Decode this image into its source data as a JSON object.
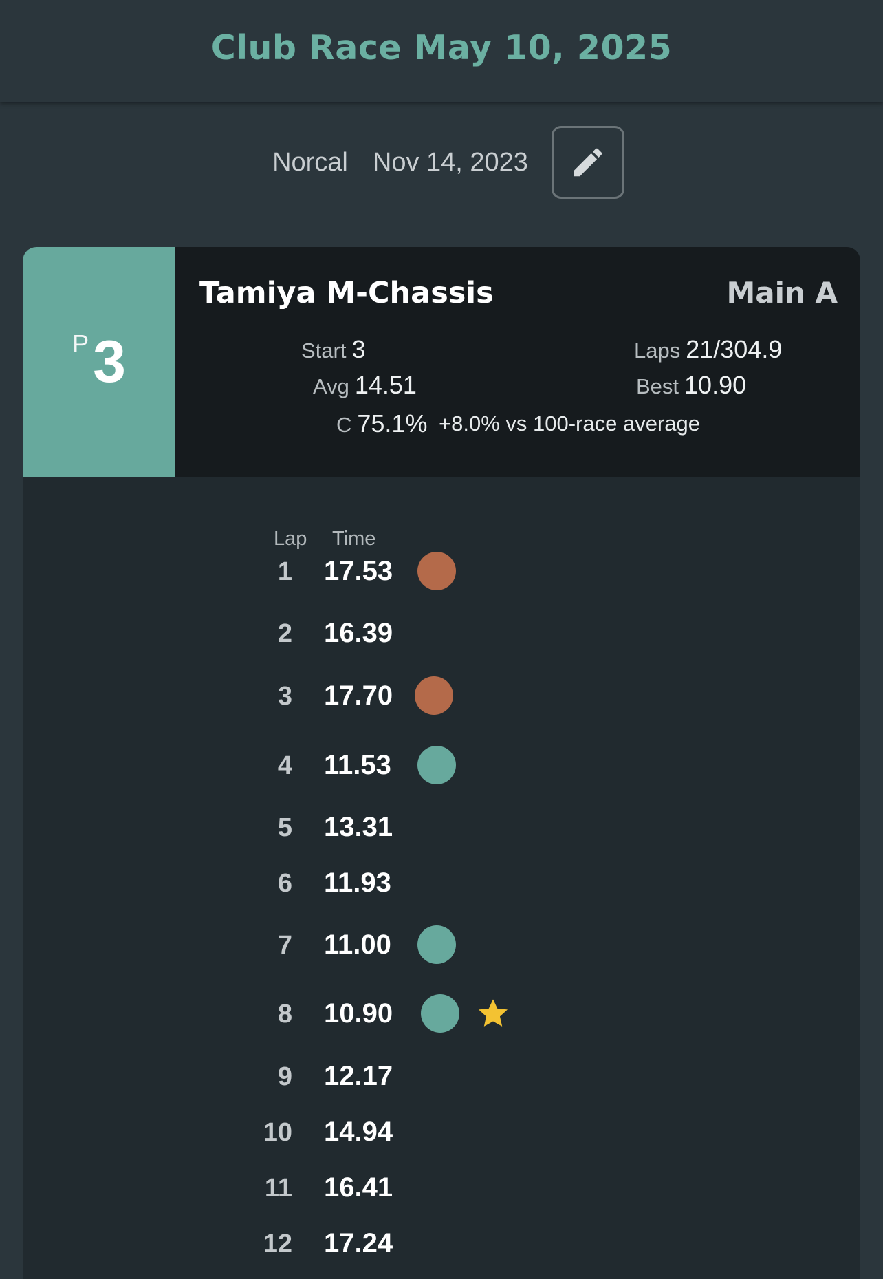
{
  "header": {
    "title": "Club Race May 10, 2025"
  },
  "meta": {
    "track": "Norcal",
    "date": "Nov 14, 2023",
    "edit_icon": "pencil-icon"
  },
  "result": {
    "position_prefix": "P",
    "position": "3",
    "car": "Tamiya M-Chassis",
    "race_class": "Main A",
    "start_label": "Start",
    "start_value": "3",
    "avg_label": "Avg",
    "avg_value": "14.51",
    "laps_label": "Laps",
    "laps_value": "21/304.9",
    "best_label": "Best",
    "best_value": "10.90",
    "consistency_label": "C",
    "consistency_value": "75.1%",
    "comparison": "+8.0% vs 100-race average"
  },
  "laps": {
    "col_lap": "Lap",
    "col_time": "Time",
    "colors": {
      "slow": "#b46a4a",
      "fast": "#67a99d",
      "star": "#f3c232"
    },
    "rows": [
      {
        "lap": "1",
        "time": "17.53",
        "marker": "slow"
      },
      {
        "lap": "2",
        "time": "16.39",
        "marker": ""
      },
      {
        "lap": "3",
        "time": "17.70",
        "marker": "slow"
      },
      {
        "lap": "4",
        "time": "11.53",
        "marker": "fast"
      },
      {
        "lap": "5",
        "time": "13.31",
        "marker": ""
      },
      {
        "lap": "6",
        "time": "11.93",
        "marker": ""
      },
      {
        "lap": "7",
        "time": "11.00",
        "marker": "fast"
      },
      {
        "lap": "8",
        "time": "10.90",
        "marker": "fast",
        "best": true
      },
      {
        "lap": "9",
        "time": "12.17",
        "marker": ""
      },
      {
        "lap": "10",
        "time": "14.94",
        "marker": ""
      },
      {
        "lap": "11",
        "time": "16.41",
        "marker": ""
      },
      {
        "lap": "12",
        "time": "17.24",
        "marker": ""
      }
    ]
  }
}
